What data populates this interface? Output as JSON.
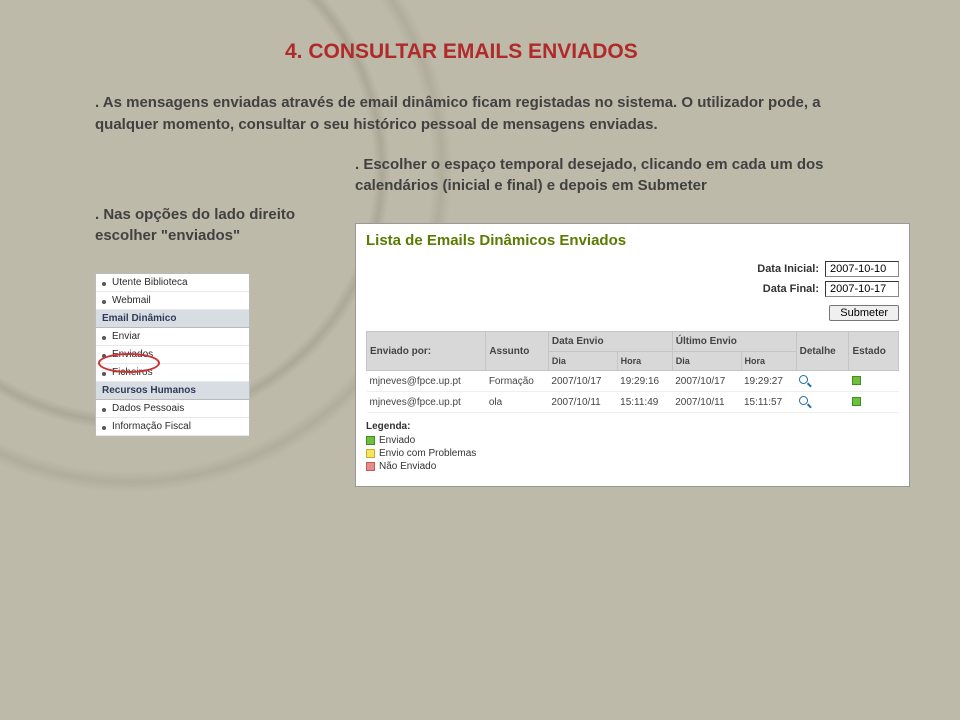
{
  "heading": "4. CONSULTAR EMAILS ENVIADOS",
  "intro": ". As mensagens enviadas através de email dinâmico ficam registadas no sistema. O utilizador pode, a qualquer momento, consultar o seu histórico pessoal de mensagens enviadas.",
  "note_left": ". Nas opções do lado direito escolher \"enviados\"",
  "note_right": ". Escolher o espaço temporal desejado, clicando em cada um dos calendários (inicial e final) e depois em Submeter",
  "sidebar": {
    "items_top": [
      "Utente Biblioteca",
      "Webmail"
    ],
    "head1": "Email Dinâmico",
    "items_mid": [
      "Enviar",
      "Enviados",
      "Ficheiros"
    ],
    "head2": "Recursos Humanos",
    "items_bot": [
      "Dados Pessoais",
      "Informação Fiscal"
    ]
  },
  "panel": {
    "title": "Lista de Emails Dinâmicos Enviados",
    "label_inicial": "Data Inicial:",
    "label_final": "Data Final:",
    "date_inicial": "2007-10-10",
    "date_final": "2007-10-17",
    "submit": "Submeter",
    "cols": {
      "enviado_por": "Enviado por:",
      "assunto": "Assunto",
      "data_envio": "Data Envio",
      "ultimo_envio": "Último Envio",
      "dia": "Dia",
      "hora": "Hora",
      "detalhe": "Detalhe",
      "estado": "Estado"
    },
    "rows": [
      {
        "por": "mjneves@fpce.up.pt",
        "assunto": "Formação",
        "de_dia": "2007/10/17",
        "de_hora": "19:29:16",
        "ue_dia": "2007/10/17",
        "ue_hora": "19:29:27"
      },
      {
        "por": "mjneves@fpce.up.pt",
        "assunto": "ola",
        "de_dia": "2007/10/11",
        "de_hora": "15:11:49",
        "ue_dia": "2007/10/11",
        "ue_hora": "15:11:57"
      }
    ],
    "legend": {
      "title": "Legenda:",
      "enviado": "Enviado",
      "problemas": "Envio com Problemas",
      "nao": "Não Enviado"
    }
  }
}
